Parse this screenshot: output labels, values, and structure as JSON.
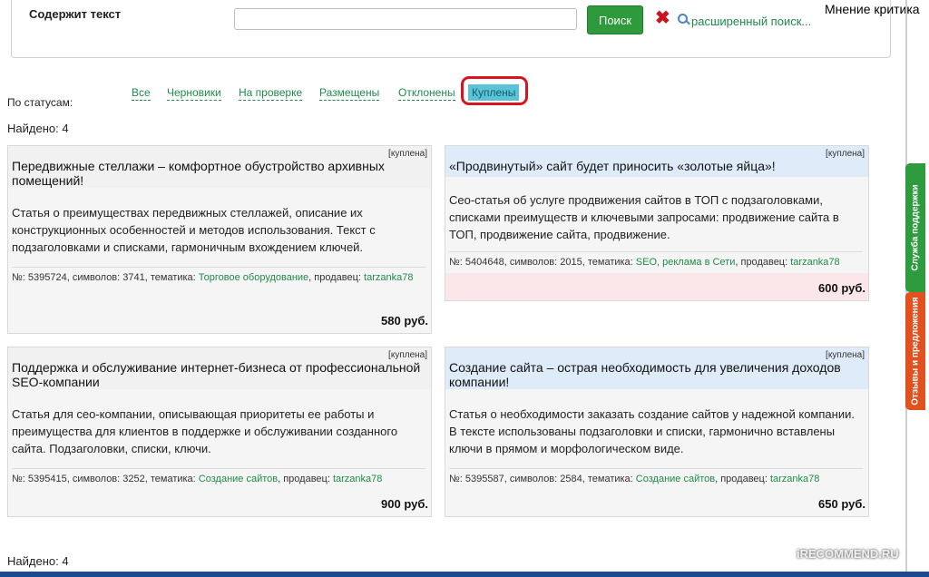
{
  "search": {
    "label": "Содержит текст",
    "value": "",
    "placeholder": "",
    "button": "Поиск",
    "advanced": "расширенный поиск..."
  },
  "top_right_label": "Мнение критика",
  "status": {
    "label": "По статусам:",
    "filters": [
      "Все",
      "Черновики",
      "На проверке",
      "Размещены",
      "Отклонены",
      "Куплены"
    ],
    "active": "Куплены"
  },
  "found_text": "Найдено: 4",
  "cards": [
    {
      "badge": "[куплена]",
      "title": "Передвижные стеллажи – комфортное обустройство архивных помещений!",
      "desc": "Статья о преимуществах передвижных стеллажей, описание их конструкционных особенностей и методов использования. Текст с подзаголовками и списками, гармоничным вхождением ключей.",
      "meta_prefix": "№: 5395724, символов: 3741, тематика:",
      "topic": "Торговое оборудование",
      "seller_label": ", продавец:",
      "seller": "tarzanka78",
      "price": "580 руб."
    },
    {
      "badge": "[куплена]",
      "title": "«Продвинутый» сайт будет приносить «золотые яйца»!",
      "desc": "Сео-статья об услуге продвижения сайтов в ТОП с подзаголовками, списками преимуществ и ключевыми запросами: продвижение сайта в ТОП, продвижение сайта, продвижение.",
      "meta_prefix": "№: 5404648, символов: 2015, тематика:",
      "topic": "SEO, реклама в Сети",
      "seller_label": ", продавец:",
      "seller": "tarzanka78",
      "price": "600 руб."
    },
    {
      "badge": "[куплена]",
      "title": "Поддержка и обслуживание интернет-бизнеса от профессиональной SEO-компании",
      "desc": "Статья для сео-компании, описывающая приоритеты ее работы и преимущества для клиентов в поддержке и обслуживании созданного сайта. Подзаголовки, списки, ключи.",
      "meta_prefix": "№: 5395415, символов: 3252, тематика:",
      "topic": "Создание сайтов",
      "seller_label": ", продавец:",
      "seller": "tarzanka78",
      "price": "900 руб."
    },
    {
      "badge": "[куплена]",
      "title": "Создание сайта – острая необходимость для увеличения доходов компании!",
      "desc": "Статья о необходимости заказать создание сайтов у надежной компании. В тексте использованы подзаголовки и списки, гармонично вставлены ключи в прямом и морфологическом виде.",
      "meta_prefix": "№: 5395587, символов: 2584, тематика:",
      "topic": "Создание сайтов",
      "seller_label": ", продавец:",
      "seller": "tarzanka78",
      "price": "650 руб."
    }
  ],
  "side_tabs": [
    "Служба поддержки",
    "Отзывы и предложения"
  ],
  "watermark": "iRECOMMEND.RU",
  "colors": {
    "accent_green": "#2e9a3b",
    "link_green": "#1f8a4a",
    "active_filter": "#5bc3d8",
    "highlight_red": "#d8141e"
  }
}
